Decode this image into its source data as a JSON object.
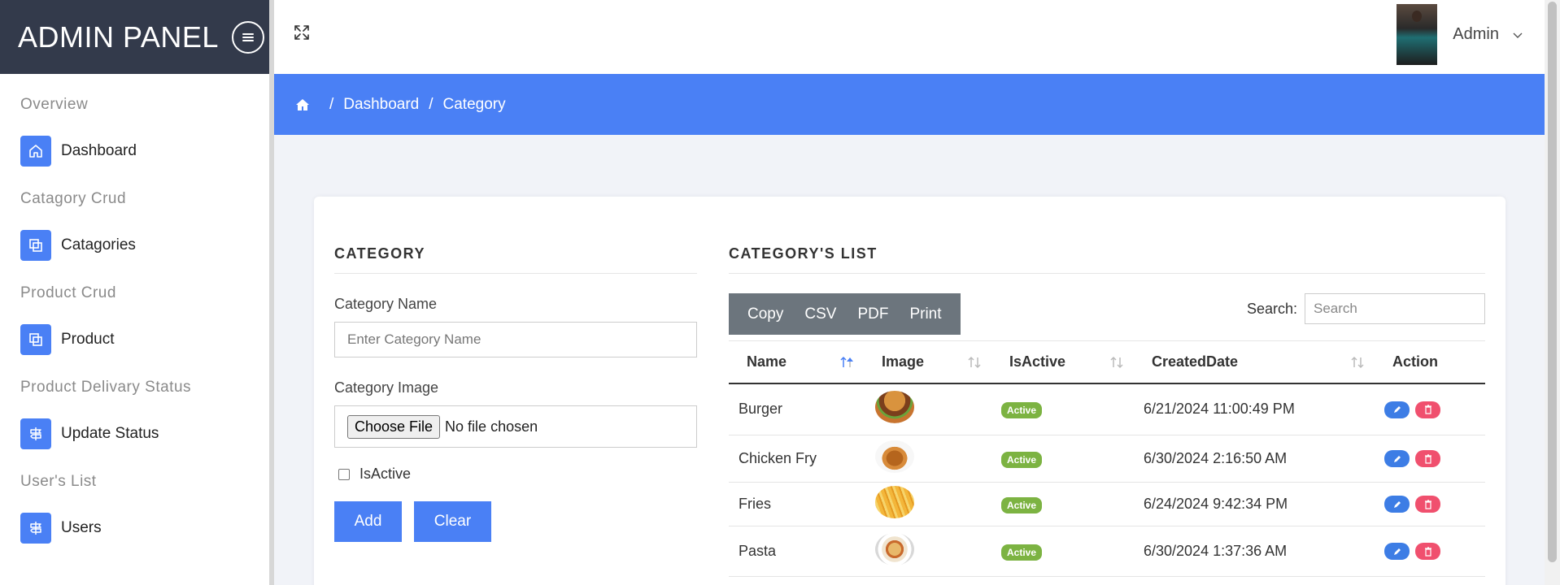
{
  "brand": {
    "title": "ADMIN PANEL"
  },
  "sidebar": {
    "sections": [
      {
        "title": "Overview",
        "item": "Dashboard",
        "icon": "home-icon"
      },
      {
        "title": "Catagory Crud",
        "item": "Catagories",
        "icon": "copy-icon"
      },
      {
        "title": "Product Crud",
        "item": "Product",
        "icon": "copy-icon"
      },
      {
        "title": "Product Delivary Status",
        "item": "Update Status",
        "icon": "signpost-icon"
      },
      {
        "title": "User's List",
        "item": "Users",
        "icon": "signpost-icon"
      }
    ]
  },
  "topbar": {
    "user_name": "Admin"
  },
  "breadcrumb": {
    "items": [
      "Dashboard",
      "Category"
    ],
    "separator": "/"
  },
  "form": {
    "title": "CATEGORY",
    "name_label": "Category Name",
    "name_placeholder": "Enter Category Name",
    "image_label": "Category Image",
    "file_button": "Choose File",
    "file_status": "No file chosen",
    "active_label": "IsActive",
    "add_button": "Add",
    "clear_button": "Clear"
  },
  "list": {
    "title": "CATEGORY'S LIST",
    "export_buttons": [
      "Copy",
      "CSV",
      "PDF",
      "Print"
    ],
    "search_label": "Search:",
    "search_placeholder": "Search",
    "columns": [
      "Name",
      "Image",
      "IsActive",
      "CreatedDate",
      "Action"
    ],
    "rows": [
      {
        "name": "Burger",
        "status": "Active",
        "created": "6/21/2024 11:00:49 PM"
      },
      {
        "name": "Chicken Fry",
        "status": "Active",
        "created": "6/30/2024 2:16:50 AM"
      },
      {
        "name": "Fries",
        "status": "Active",
        "created": "6/24/2024 9:42:34 PM"
      },
      {
        "name": "Pasta",
        "status": "Active",
        "created": "6/30/2024 1:37:36 AM"
      }
    ]
  },
  "colors": {
    "accent": "#4a80f5",
    "sidebar_header": "#333a4b",
    "badge": "#7cb342",
    "delete": "#f0506e",
    "export_bar": "#6c757d"
  }
}
